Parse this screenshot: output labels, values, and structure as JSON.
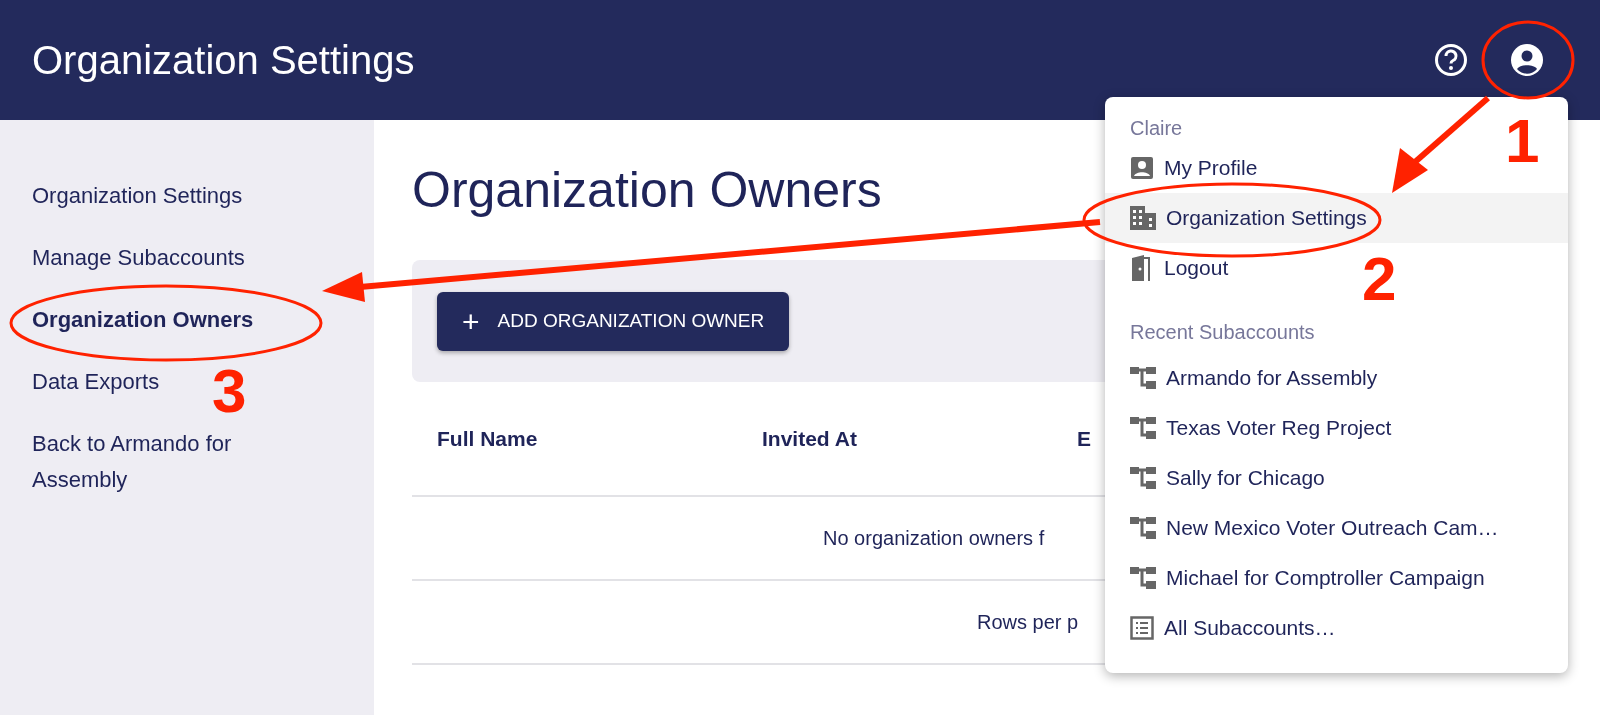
{
  "header": {
    "title": "Organization Settings"
  },
  "sidebar": {
    "items": [
      {
        "label": "Organization Settings",
        "selected": false
      },
      {
        "label": "Manage Subaccounts",
        "selected": false
      },
      {
        "label": "Organization Owners",
        "selected": true
      },
      {
        "label": "Data Exports",
        "selected": false
      },
      {
        "label": "Back to Armando for Assembly",
        "selected": false
      }
    ]
  },
  "main": {
    "heading": "Organization Owners",
    "add_button": {
      "icon": "+",
      "label": "ADD ORGANIZATION OWNER"
    },
    "table": {
      "columns": [
        "Full Name",
        "Invited At",
        "E"
      ],
      "empty_message": "No organization owners f",
      "footer": "Rows per p"
    }
  },
  "account_menu": {
    "user": "Claire",
    "items": [
      {
        "kind": "profile",
        "label": "My Profile",
        "selected": false
      },
      {
        "kind": "building",
        "label": "Organization Settings",
        "selected": true
      },
      {
        "kind": "logout",
        "label": "Logout",
        "selected": false
      }
    ],
    "section_title": "Recent Subaccounts",
    "subaccounts": [
      {
        "kind": "subaccount",
        "label": "Armando for Assembly"
      },
      {
        "kind": "subaccount",
        "label": "Texas Voter Reg Project"
      },
      {
        "kind": "subaccount",
        "label": "Sally for Chicago"
      },
      {
        "kind": "subaccount",
        "label": "New Mexico Voter Outreach Cam…"
      },
      {
        "kind": "subaccount",
        "label": "Michael for Comptroller Campaign"
      },
      {
        "kind": "list",
        "label": "All Subaccounts…"
      }
    ]
  },
  "annotations": [
    {
      "label": "1"
    },
    {
      "label": "2"
    },
    {
      "label": "3"
    }
  ]
}
